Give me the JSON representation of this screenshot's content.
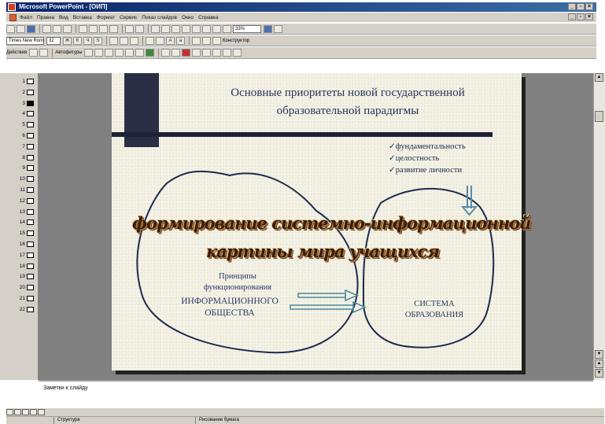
{
  "window": {
    "title": "Microsoft PowerPoint - [ОИП]",
    "min": "_",
    "restore": "▫",
    "close": "×"
  },
  "menu": [
    "Файл",
    "Правка",
    "Вид",
    "Вставка",
    "Формат",
    "Сервис",
    "Показ слайдов",
    "Окно",
    "Справка"
  ],
  "toolbar": {
    "zoom": "33%",
    "font_name": "Times New Roman",
    "font_size": "32",
    "designer_label": "Конструктор",
    "actions_label": "Действия",
    "autoshapes_label": "Автофигуры"
  },
  "outline": {
    "slides": [
      "1",
      "2",
      "3",
      "4",
      "5",
      "6",
      "7",
      "8",
      "9",
      "10",
      "11",
      "12",
      "13",
      "14",
      "15",
      "16",
      "17",
      "18",
      "19",
      "20",
      "21",
      "22"
    ],
    "current": "3"
  },
  "slide": {
    "title_line1": "Основные приоритеты новой государственной",
    "title_line2": "образовательной парадигмы",
    "checks": [
      "✓фундаментальность",
      "✓целостность",
      "✓развитие личности"
    ],
    "big_line1": "формирование системно-информационной",
    "big_line2": "картины мира учащихся",
    "principles_line1": "Принципы",
    "principles_line2": "функционирования",
    "principles_line3": "ИНФОРМАЦИОННОГО",
    "principles_line4": "ОБЩЕСТВА",
    "system_line1": "СИСТЕМА",
    "system_line2": "ОБРАЗОВАНИЯ"
  },
  "notes": {
    "placeholder": "Заметки к слайду"
  },
  "status": {
    "cell1": "Структура",
    "cell2": "Рисование бумага"
  },
  "colors": {
    "title_text": "#2a3460",
    "slide_bg": "#f4f2e4",
    "ui_gray": "#d4d0c8"
  }
}
